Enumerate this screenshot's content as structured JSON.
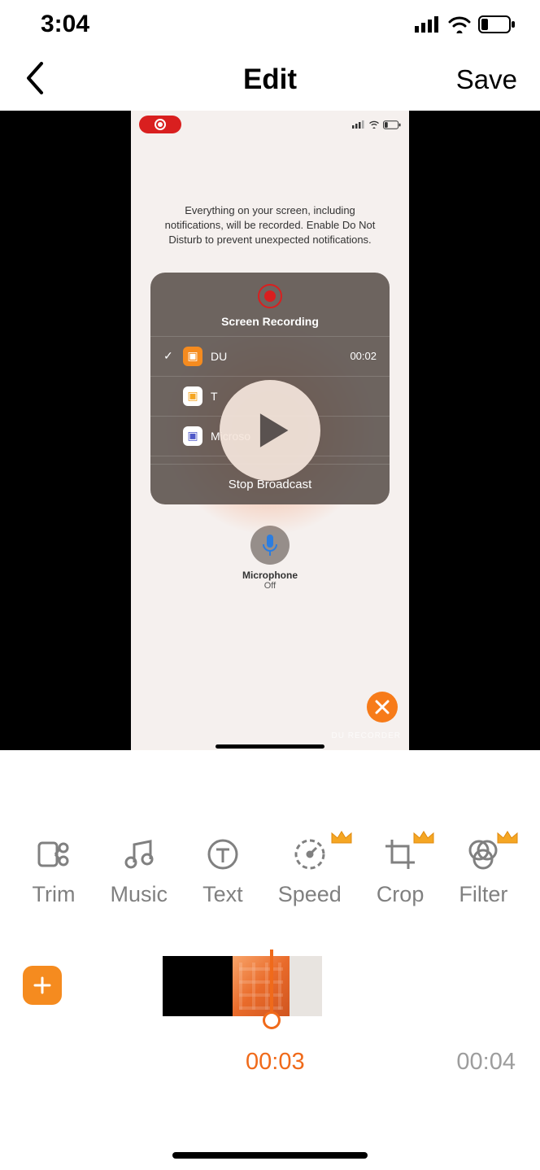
{
  "status": {
    "time": "3:04"
  },
  "nav": {
    "title": "Edit",
    "save": "Save"
  },
  "preview": {
    "message": "Everything on your screen, including notifications, will be recorded. Enable Do Not Disturb to prevent unexpected notifications.",
    "card": {
      "title": "Screen Recording",
      "rows": [
        {
          "app": "DU",
          "time": "00:02",
          "selected": true,
          "icon_bg": "#f58b1f",
          "icon_glyph": "📹"
        },
        {
          "app": "T",
          "time": "",
          "selected": false,
          "icon_bg": "#fff",
          "icon_glyph": "📹"
        },
        {
          "app": "Microso",
          "time": "",
          "selected": false,
          "icon_bg": "#fff",
          "icon_glyph": "👥"
        }
      ],
      "stop": "Stop Broadcast"
    },
    "mic": {
      "label": "Microphone",
      "sub": "Off"
    },
    "watermark": "DU RECORDER"
  },
  "tools": [
    {
      "label": "Trim",
      "premium": false
    },
    {
      "label": "Music",
      "premium": false
    },
    {
      "label": "Text",
      "premium": false
    },
    {
      "label": "Speed",
      "premium": true
    },
    {
      "label": "Crop",
      "premium": true
    },
    {
      "label": "Filter",
      "premium": true
    }
  ],
  "timeline": {
    "current": "00:03",
    "total": "00:04"
  }
}
